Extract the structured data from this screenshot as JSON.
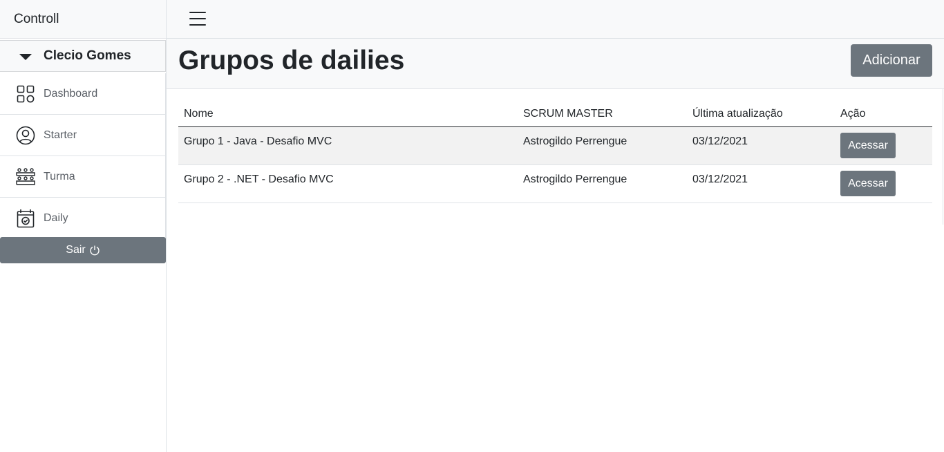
{
  "app": {
    "brand": "Controll"
  },
  "user": {
    "name": "Clecio Gomes"
  },
  "sidebar": {
    "items": [
      {
        "label": "Dashboard",
        "icon": "dashboard-grid-icon"
      },
      {
        "label": "Starter",
        "icon": "user-circle-icon"
      },
      {
        "label": "Turma",
        "icon": "class-group-icon"
      },
      {
        "label": "Daily",
        "icon": "calendar-check-icon"
      }
    ],
    "logout_label": "Sair",
    "logout_icon": "power-icon"
  },
  "topbar": {
    "menu_icon": "hamburger-menu-icon"
  },
  "header": {
    "title": "Grupos de dailies",
    "add_label": "Adicionar"
  },
  "table": {
    "columns": [
      "Nome",
      "SCRUM MASTER",
      "Última atualização",
      "Ação"
    ],
    "rows": [
      {
        "name": "Grupo 1 - Java - Desafio MVC",
        "scrum_master": "Astrogildo Perrengue",
        "updated": "03/12/2021",
        "action": "Acessar"
      },
      {
        "name": "Grupo 2 - .NET - Desafio MVC",
        "scrum_master": "Astrogildo Perrengue",
        "updated": "03/12/2021",
        "action": "Acessar"
      }
    ]
  },
  "colors": {
    "button": "#6c757d",
    "panel": "#f8f9fa",
    "border": "#dee2e6",
    "stripe": "#f2f2f2"
  }
}
